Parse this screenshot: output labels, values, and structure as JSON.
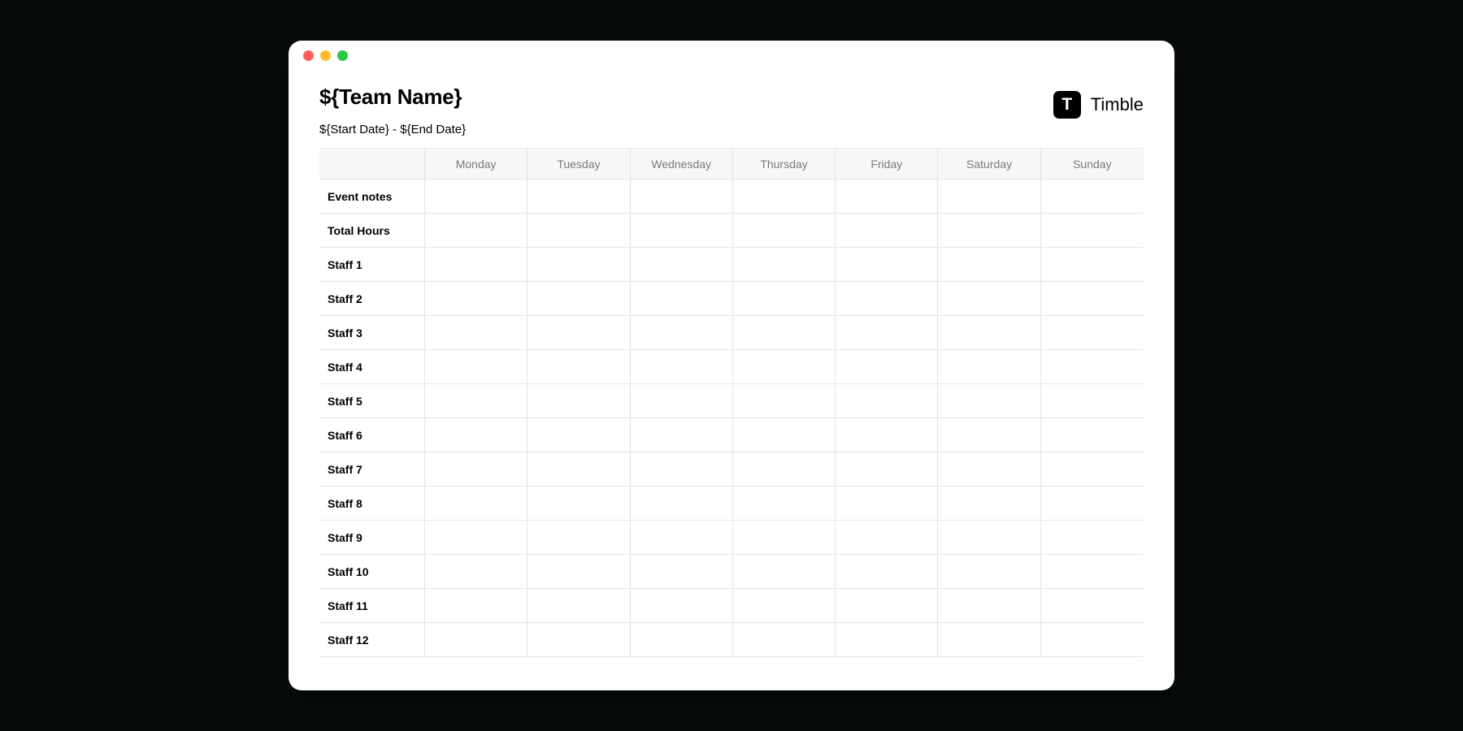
{
  "header": {
    "title": "${Team Name}",
    "date_range": "${Start Date} - ${End Date}"
  },
  "brand": {
    "icon_letter": "T",
    "name": "Timble"
  },
  "columns": [
    "Monday",
    "Tuesday",
    "Wednesday",
    "Thursday",
    "Friday",
    "Saturday",
    "Sunday"
  ],
  "fixed_rows": [
    {
      "label": "Event notes"
    },
    {
      "label": "Total Hours"
    }
  ],
  "staff_rows": [
    {
      "label": "Staff 1"
    },
    {
      "label": "Staff 2"
    },
    {
      "label": "Staff 3"
    },
    {
      "label": "Staff 4"
    },
    {
      "label": "Staff 5"
    },
    {
      "label": "Staff 6"
    },
    {
      "label": "Staff 7"
    },
    {
      "label": "Staff 8"
    },
    {
      "label": "Staff 9"
    },
    {
      "label": "Staff 10"
    },
    {
      "label": "Staff 11"
    },
    {
      "label": "Staff 12"
    }
  ]
}
